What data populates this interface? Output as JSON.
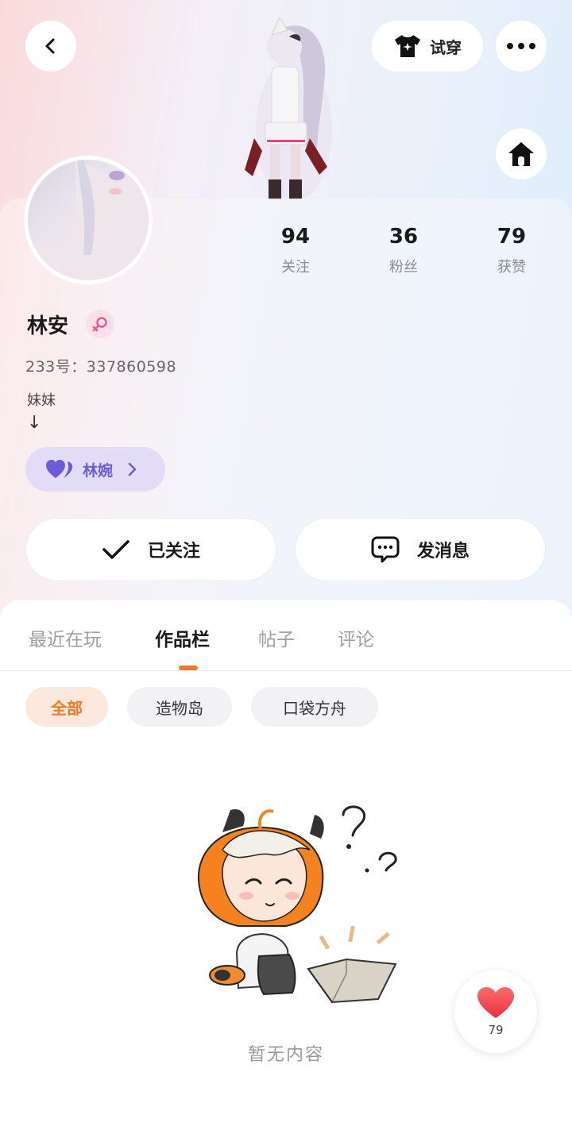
{
  "header": {
    "tryon_label": "试穿",
    "icons": [
      "chevron-left-icon",
      "tshirt-icon",
      "more-dots-icon",
      "home-icon"
    ]
  },
  "profile": {
    "name": "林安",
    "gender": "female",
    "uid_text": "233号：337860598",
    "bio": "妹妹",
    "bio_arrow": "↓",
    "couple": {
      "name": "林婉"
    }
  },
  "stats": [
    {
      "value": "94",
      "label": "关注"
    },
    {
      "value": "36",
      "label": "粉丝"
    },
    {
      "value": "79",
      "label": "获赞"
    }
  ],
  "actions": {
    "follow_label": "已关注",
    "message_label": "发消息"
  },
  "tabs": [
    {
      "label": "最近在玩"
    },
    {
      "label": "作品栏",
      "active": true
    },
    {
      "label": "帖子"
    },
    {
      "label": "评论"
    }
  ],
  "filters": [
    {
      "label": "全部",
      "active": true
    },
    {
      "label": "造物岛"
    },
    {
      "label": "口袋方舟"
    }
  ],
  "empty_state": {
    "text": "暂无内容"
  },
  "like_fab": {
    "count": "79"
  },
  "colors": {
    "accent": "#f07a2a",
    "couple": "#6b5bd6",
    "heart": "#f0474f"
  }
}
